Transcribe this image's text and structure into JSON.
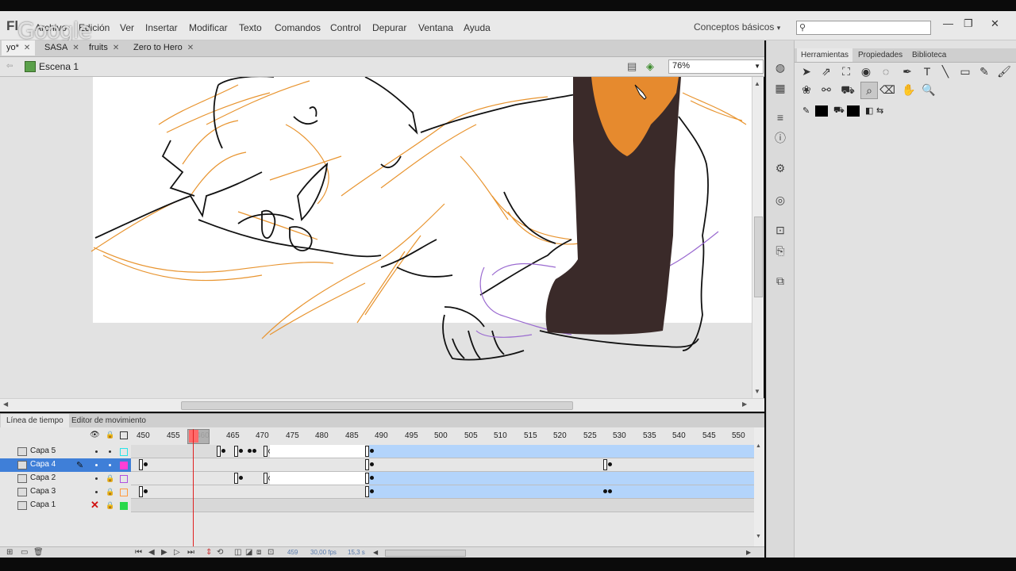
{
  "app": {
    "logo": "Fl",
    "watermark": "Google",
    "workspace": "Conceptos básicos",
    "workspace_arrow": "▾",
    "search_placeholder": "",
    "window_buttons": [
      "—",
      "❐",
      "✕"
    ]
  },
  "menu": [
    "Archivo",
    "Edición",
    "Ver",
    "Insertar",
    "Modificar",
    "Texto",
    "Comandos",
    "Control",
    "Depurar",
    "Ventana",
    "Ayuda"
  ],
  "doc_tabs": [
    {
      "label": "yo*",
      "active": true
    },
    {
      "label": "SASA",
      "active": false
    },
    {
      "label": "fruits",
      "active": false
    },
    {
      "label": "Zero to Hero",
      "active": false
    }
  ],
  "edit_bar": {
    "scene": "Escena 1",
    "zoom": "76%"
  },
  "panel": {
    "tabs": [
      "Herramientas",
      "Propiedades",
      "Biblioteca"
    ]
  },
  "timeline": {
    "tabs": [
      "Línea de tiempo",
      "Editor de movimiento"
    ],
    "ruler_ticks": [
      "450",
      "455",
      "460",
      "465",
      "470",
      "475",
      "480",
      "485",
      "490",
      "495",
      "500",
      "505",
      "510",
      "515",
      "520",
      "525",
      "530",
      "535",
      "540",
      "545",
      "550"
    ],
    "current_frame": "459",
    "fps": "30,00 fps",
    "elapsed": "15,3 s",
    "layers": [
      {
        "name": "Capa 5",
        "selected": false,
        "color": "#29e3e8"
      },
      {
        "name": "Capa 4",
        "selected": true,
        "color": "#ff3fd6"
      },
      {
        "name": "Capa 2",
        "selected": false,
        "color": "#b050e0"
      },
      {
        "name": "Capa 3",
        "selected": false,
        "color": "#ff9a3f"
      },
      {
        "name": "Capa 1",
        "selected": false,
        "color": "#29d84a"
      }
    ]
  },
  "colors": {
    "accent_selection": "#3f7fd8",
    "tween_span": "#b3d4fb",
    "playhead": "#e02020",
    "brown": "#3a2a29",
    "orange": "#e68a2e"
  }
}
